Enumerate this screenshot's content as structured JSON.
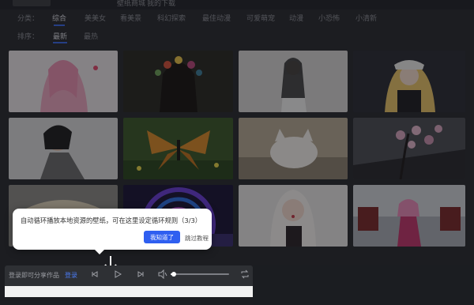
{
  "topbar": {
    "links": [
      "壁纸商城",
      "我的下载"
    ]
  },
  "categories": {
    "items": [
      "分类：",
      "综合",
      "美美女",
      "看美景",
      "科幻探索",
      "最佳动漫",
      "可爱萌宠",
      "动漫",
      "小恐怖",
      "小清新"
    ],
    "active_index": 1
  },
  "sort": {
    "items": [
      "排序：",
      "最新",
      "最热"
    ],
    "active_index": 1
  },
  "tooltip": {
    "text": "自动循环播放本地资源的壁纸，可在这里设定循环规则（3/3）",
    "confirm_label": "我知道了",
    "skip_label": "跳过教程"
  },
  "player": {
    "share_text": "登录即可分享作品",
    "login_label": "登录",
    "volume_fraction": 0.05,
    "icons": [
      "prev-icon",
      "play-icon",
      "next-icon",
      "volume-icon",
      "loop-icon"
    ]
  },
  "colors": {
    "accent": "#2f5ff0",
    "link": "#4b7bf5",
    "background": "#2a2c30"
  }
}
